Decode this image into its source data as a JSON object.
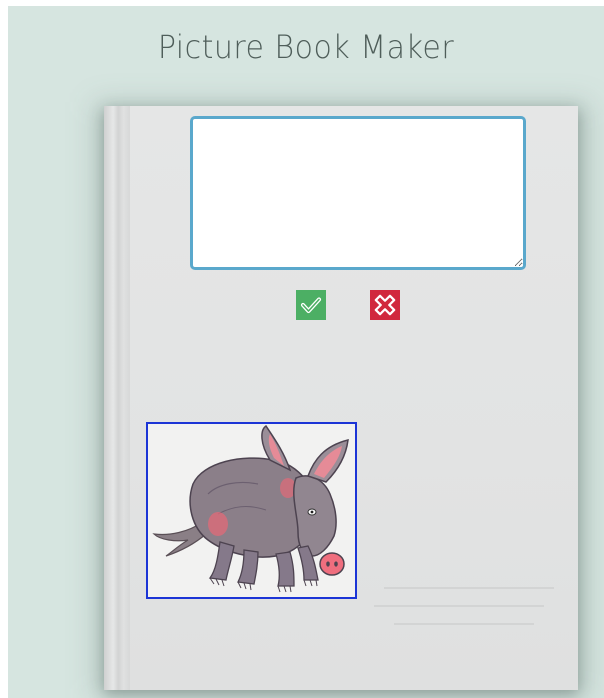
{
  "app": {
    "title": "Picture Book Maker"
  },
  "caption": {
    "value": "",
    "placeholder": ""
  },
  "colors": {
    "background": "#d6e5e0",
    "book_cover": "#e3e4e4",
    "caption_border": "#5aa8cc",
    "confirm": "#4caf64",
    "cancel": "#d1283d",
    "selection_border": "#1c35d6"
  },
  "buttons": {
    "confirm_icon": "check-icon",
    "cancel_icon": "cross-icon"
  },
  "picture": {
    "subject_icon": "aardvark-illustration"
  }
}
